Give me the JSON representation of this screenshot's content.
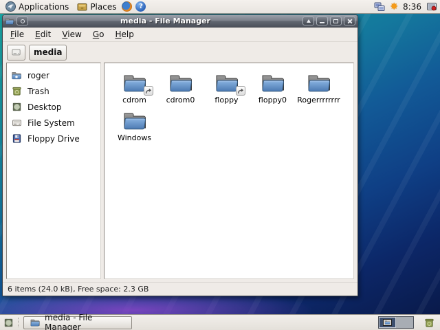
{
  "top_panel": {
    "applications_label": "Applications",
    "places_label": "Places",
    "clock": "8:36"
  },
  "icons": {
    "help_glyph": "?",
    "brightness_glyph": "✸"
  },
  "window": {
    "title": "media - File Manager",
    "menu": {
      "items": [
        {
          "label": "File"
        },
        {
          "label": "Edit"
        },
        {
          "label": "View"
        },
        {
          "label": "Go"
        },
        {
          "label": "Help"
        }
      ]
    },
    "pathbar": {
      "current": "media"
    },
    "sidebar": {
      "items": [
        {
          "label": "roger",
          "icon": "home-folder-icon"
        },
        {
          "label": "Trash",
          "icon": "trash-icon"
        },
        {
          "label": "Desktop",
          "icon": "desktop-icon"
        },
        {
          "label": "File System",
          "icon": "filesystem-icon"
        },
        {
          "label": "Floppy Drive",
          "icon": "floppy-drive-icon"
        }
      ]
    },
    "files": {
      "items": [
        {
          "name": "cdrom",
          "type": "folder",
          "symlink": true
        },
        {
          "name": "cdrom0",
          "type": "folder",
          "symlink": false
        },
        {
          "name": "floppy",
          "type": "folder",
          "symlink": true
        },
        {
          "name": "floppy0",
          "type": "folder",
          "symlink": false
        },
        {
          "name": "Rogerrrrrrrr",
          "type": "folder",
          "symlink": false
        },
        {
          "name": "Windows",
          "type": "folder",
          "symlink": false
        }
      ]
    },
    "statusbar": {
      "text": "6 items (24.0 kB), Free space: 2.3 GB"
    }
  },
  "taskbar": {
    "window_button_label": "media - File Manager",
    "workspace_count": 2,
    "active_workspace": 1
  },
  "colors": {
    "desktop_teal": "#1aa9a4",
    "desktop_navy": "#091744",
    "desktop_purple": "#8a46c8",
    "titlebar_gray": "#60656f",
    "panel_bg": "#eeeae5",
    "window_chrome": "#efebe7",
    "folder_blue": "#5c8fc8"
  }
}
